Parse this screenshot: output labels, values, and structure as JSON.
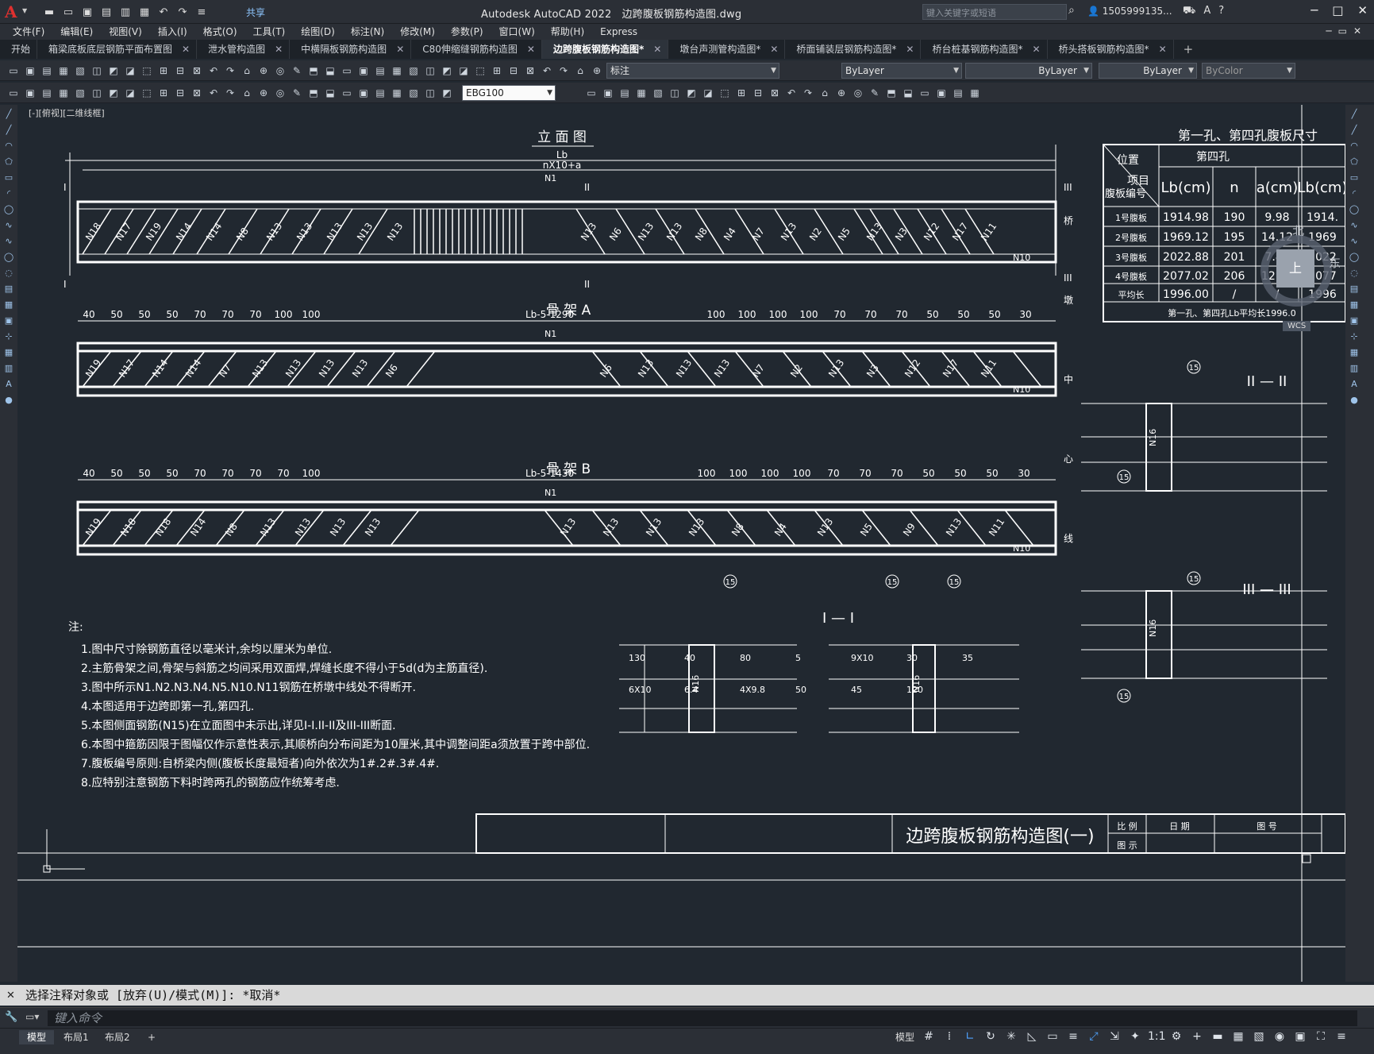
{
  "app": {
    "title": "Autodesk AutoCAD 2022",
    "document": "边跨腹板钢筋构造图.dwg",
    "share": "共享",
    "search_placeholder": "键入关键字或短语",
    "user": "1505999135..."
  },
  "menu": [
    "文件(F)",
    "编辑(E)",
    "视图(V)",
    "插入(I)",
    "格式(O)",
    "工具(T)",
    "绘图(D)",
    "标注(N)",
    "修改(M)",
    "参数(P)",
    "窗口(W)",
    "帮助(H)",
    "Express"
  ],
  "tabs": [
    {
      "label": "开始"
    },
    {
      "label": "箱梁底板底层钢筋平面布置图"
    },
    {
      "label": "泄水管构造图"
    },
    {
      "label": "中横隔板钢筋构造图"
    },
    {
      "label": "C80伸缩缝钢筋构造图"
    },
    {
      "label": "边跨腹板钢筋构造图*",
      "active": true
    },
    {
      "label": "墩台声测管构造图*"
    },
    {
      "label": "桥面铺装层钢筋构造图*"
    },
    {
      "label": "桥台桩基钢筋构造图*"
    },
    {
      "label": "桥头搭板钢筋构造图*"
    }
  ],
  "toolbar": {
    "layer": "标注",
    "color": "ByLayer",
    "linetype": "ByLayer",
    "lineweight": "ByLayer",
    "plotstyle": "ByColor",
    "dimstyle": "EBG100"
  },
  "view_label": "[-][俯视][二维线框]",
  "viewcube": {
    "n": "北",
    "e": "东",
    "top": "上",
    "wcs": "WCS"
  },
  "drawing": {
    "elevation_title": "立 面 图",
    "skeleton_a_title": "骨 架 A",
    "skeleton_b_title": "骨 架 B",
    "dim_lb": "Lb",
    "dim_nx": "nX10+a",
    "a_mid_dim": "Lb-5-1290",
    "b_mid_dim": "Lb-5-1430",
    "a_left_dims": [
      "40",
      "50",
      "50",
      "50",
      "70",
      "70",
      "70",
      "100",
      "100"
    ],
    "a_right_dims": [
      "100",
      "100",
      "100",
      "100",
      "70",
      "70",
      "70",
      "50",
      "50",
      "50",
      "30"
    ],
    "b_left_dims": [
      "40",
      "50",
      "50",
      "50",
      "70",
      "70",
      "70",
      "70",
      "100"
    ],
    "b_right_dims": [
      "100",
      "100",
      "100",
      "100",
      "70",
      "70",
      "70",
      "50",
      "50",
      "50",
      "30"
    ],
    "elev_left_labels": [
      "N18",
      "N17",
      "N19",
      "N14",
      "N14",
      "N8",
      "N13",
      "N13",
      "N13",
      "N13",
      "N13"
    ],
    "elev_right_labels": [
      "N13",
      "N6",
      "N13",
      "N13",
      "N8",
      "N4",
      "N7",
      "N13",
      "N2",
      "N5",
      "N13",
      "N3",
      "N12",
      "N17",
      "N11"
    ],
    "a_left_labels": [
      "N19",
      "N17",
      "N14",
      "N14",
      "N7",
      "N13",
      "N13",
      "N13",
      "N13",
      "N6"
    ],
    "a_right_labels": [
      "N6",
      "N13",
      "N13",
      "N13",
      "N7",
      "N2",
      "N13",
      "N3",
      "N12",
      "N17",
      "N11"
    ],
    "b_left_labels": [
      "N19",
      "N18",
      "N18",
      "N14",
      "N8",
      "N13",
      "N13",
      "N13",
      "N13"
    ],
    "b_right_labels": [
      "N13",
      "N13",
      "N13",
      "N13",
      "N8",
      "N4",
      "N13",
      "N5",
      "N9",
      "N13",
      "N11"
    ],
    "label_n1": "N1",
    "label_n10": "N10",
    "label_n16": "N16",
    "section_marks": [
      "I",
      "II",
      "III"
    ],
    "section_i_title": "I — I",
    "section_ii_title": "II — II",
    "section_iii_title": "III — III",
    "side_text": [
      "桥",
      "墩",
      "中",
      "心",
      "线"
    ],
    "notes_title": "注:",
    "notes": [
      "1.图中尺寸除钢筋直径以毫米计,余均以厘米为单位.",
      "2.主筋骨架之间,骨架与斜筋之均间采用双面焊,焊缝长度不得小于5d(d为主筋直径).",
      "3.图中所示N1.N2.N3.N4.N5.N10.N11钢筋在桥墩中线处不得断开.",
      "4.本图适用于边跨即第一孔,第四孔.",
      "5.本图侧面钢筋(N15)在立面图中未示出,详见I-I.II-II及III-III断面.",
      "6.本图中箍筋因限于图幅仅作示意性表示,其顺桥向分布间距为10厘米,其中调整间距a须放置于跨中部位.",
      "7.腹板编号原则:自桥梁内侧(腹板长度最短者)向外依次为1#.2#.3#.4#.",
      "8.应特别注意钢筋下料时跨两孔的钢筋应作统筹考虑."
    ],
    "table_title": "第一孔、第四孔腹板尺寸",
    "table_headers": [
      "位置",
      "项目",
      "腹板编号",
      "第四孔",
      "Lb(cm)",
      "n",
      "a(cm)",
      "Lb(cm)"
    ],
    "table_rows": [
      [
        "1号腹板",
        "1914.98",
        "190",
        "9.98",
        "1914."
      ],
      [
        "2号腹板",
        "1969.12",
        "195",
        "14.12",
        "1969"
      ],
      [
        "3号腹板",
        "2022.88",
        "201",
        "7.88",
        "2022"
      ],
      [
        "4号腹板",
        "2077.02",
        "206",
        "12.02",
        "2077"
      ],
      [
        "平均长",
        "1996.00",
        "/",
        "/",
        "1996"
      ]
    ],
    "table_footer": "第一孔、第四孔Lb平均长1996.0",
    "sheet_title": "边跨腹板钢筋构造图(一)",
    "titleblock": [
      "比 例",
      "日 期",
      "图 号",
      "图 示"
    ],
    "dims_section": [
      "130",
      "40",
      "80",
      "5",
      "9X10",
      "30",
      "35",
      "6X10",
      "6.4",
      "4X9.8",
      "50",
      "45",
      "120"
    ],
    "circle15": "15"
  },
  "command": {
    "history": "选择注释对象或 [放弃(U)/模式(M)]: *取消*",
    "placeholder": "键入命令"
  },
  "status": {
    "tabs": [
      "模型",
      "布局1",
      "布局2"
    ],
    "model_label": "模型",
    "scale": "1:1"
  }
}
